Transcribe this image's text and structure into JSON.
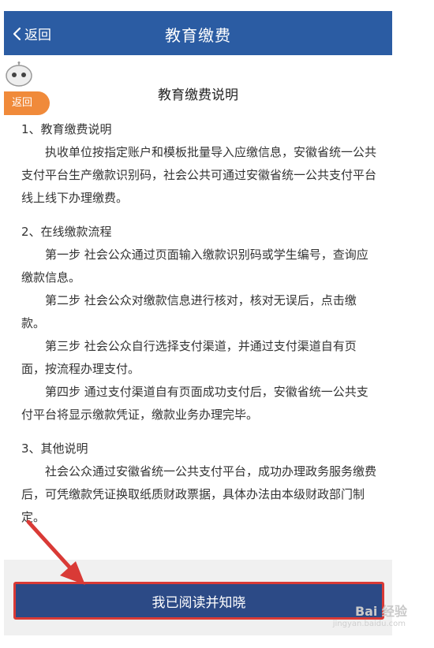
{
  "header": {
    "back_label": "返回",
    "title": "教育缴费"
  },
  "floating": {
    "back_bubble": "返回"
  },
  "document": {
    "title": "教育缴费说明",
    "sections": [
      {
        "heading": "1、教育缴费说明",
        "paragraphs": [
          "执收单位按指定账户和模板批量导入应缴信息，安徽省统一公共支付平台生产缴款识别码，社会公共可通过安徽省统一公共支付平台线上线下办理缴费。"
        ]
      },
      {
        "heading": "2、在线缴款流程",
        "paragraphs": [
          "第一步 社会公众通过页面输入缴款识别码或学生编号，查询应缴款信息。",
          "第二步 社会公众对缴款信息进行核对，核对无误后，点击缴款。",
          "第三步 社会公众自行选择支付渠道，并通过支付渠道自有页面，按流程办理支付。",
          "第四步 通过支付渠道自有页面成功支付后，安徽省统一公共支付平台将显示缴款凭证，缴款业务办理完毕。"
        ]
      },
      {
        "heading": "3、其他说明",
        "paragraphs": [
          "社会公众通过安徽省统一公共支付平台，成功办理政务服务缴费后，可凭缴款凭证换取纸质财政票据，具体办法由本级财政部门制定。"
        ]
      }
    ]
  },
  "footer": {
    "confirm_label": "我已阅读并知晓"
  },
  "watermark": {
    "text": "Bai 经验",
    "sub": "jingyan.baidu.com"
  },
  "colors": {
    "nav": "#2b5ca3",
    "button": "#2c4a86",
    "highlight": "#d93a36",
    "bubble": "#f08a3a"
  }
}
